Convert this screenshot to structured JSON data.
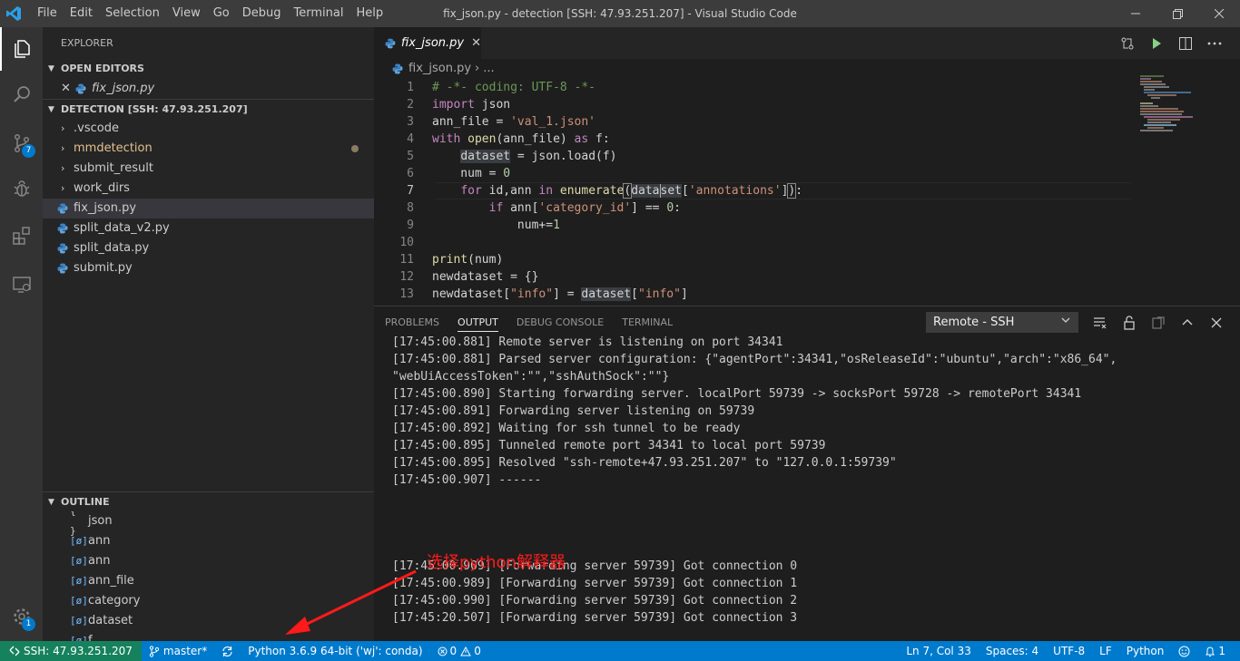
{
  "titlebar": {
    "title": "fix_json.py - detection [SSH: 47.93.251.207] - Visual Studio Code",
    "menu": [
      "File",
      "Edit",
      "Selection",
      "View",
      "Go",
      "Debug",
      "Terminal",
      "Help"
    ]
  },
  "activity": {
    "scm_badge": "7",
    "manage_badge": "1"
  },
  "sidebar": {
    "title": "EXPLORER",
    "open_editors": {
      "header": "OPEN EDITORS",
      "items": [
        {
          "name": "fix_json.py"
        }
      ]
    },
    "folder": {
      "header": "DETECTION [SSH: 47.93.251.207]",
      "items": [
        {
          "name": ".vscode",
          "type": "folder"
        },
        {
          "name": "mmdetection",
          "type": "folder"
        },
        {
          "name": "submit_result",
          "type": "folder"
        },
        {
          "name": "work_dirs",
          "type": "folder"
        },
        {
          "name": "fix_json.py",
          "type": "file"
        },
        {
          "name": "split_data_v2.py",
          "type": "file"
        },
        {
          "name": "split_data.py",
          "type": "file"
        },
        {
          "name": "submit.py",
          "type": "file"
        }
      ]
    },
    "outline": {
      "header": "OUTLINE",
      "items": [
        {
          "icon": "{ }",
          "name": "json"
        },
        {
          "icon": "[ø]",
          "name": "ann"
        },
        {
          "icon": "[ø]",
          "name": "ann"
        },
        {
          "icon": "[ø]",
          "name": "ann_file"
        },
        {
          "icon": "[ø]",
          "name": "category"
        },
        {
          "icon": "[ø]",
          "name": "dataset"
        },
        {
          "icon": "[ø]",
          "name": "f"
        }
      ]
    }
  },
  "editor": {
    "tab_label": "fix_json.py",
    "breadcrumb_file": "fix_json.py",
    "breadcrumb_more": "...",
    "lines": [
      "1",
      "2",
      "3",
      "4",
      "5",
      "6",
      "7",
      "8",
      "9",
      "10",
      "11",
      "12",
      "13"
    ]
  },
  "panel": {
    "tabs": [
      "PROBLEMS",
      "OUTPUT",
      "DEBUG CONSOLE",
      "TERMINAL"
    ],
    "select_value": "Remote - SSH",
    "output": [
      "[17:45:00.881] Remote server is listening on port 34341",
      "[17:45:00.881] Parsed server configuration: {\"agentPort\":34341,\"osReleaseId\":\"ubuntu\",\"arch\":\"x86_64\",",
      "\"webUiAccessToken\":\"\",\"sshAuthSock\":\"\"}",
      "[17:45:00.890] Starting forwarding server. localPort 59739 -> socksPort 59728 -> remotePort 34341",
      "[17:45:00.891] Forwarding server listening on 59739",
      "[17:45:00.892] Waiting for ssh tunnel to be ready",
      "[17:45:00.895] Tunneled remote port 34341 to local port 59739",
      "[17:45:00.895] Resolved \"ssh-remote+47.93.251.207\" to \"127.0.0.1:59739\"",
      "[17:45:00.907] ------",
      "",
      "",
      "",
      "",
      "[17:45:00.909] [Forwarding server 59739] Got connection 0",
      "[17:45:00.989] [Forwarding server 59739] Got connection 1",
      "[17:45:00.990] [Forwarding server 59739] Got connection 2",
      "[17:45:20.507] [Forwarding server 59739] Got connection 3"
    ],
    "annotation": "选择python解释器"
  },
  "status": {
    "remote": "SSH: 47.93.251.207",
    "branch": "master*",
    "interpreter": "Python 3.6.9 64-bit ('wj': conda)",
    "errors": "0",
    "warnings": "0",
    "position": "Ln 7, Col 33",
    "spaces": "Spaces: 4",
    "encoding": "UTF-8",
    "eol": "LF",
    "language": "Python",
    "notifications": "1"
  }
}
